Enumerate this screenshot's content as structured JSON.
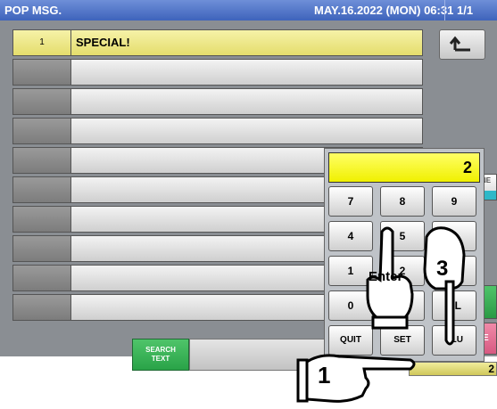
{
  "titlebar": {
    "title": "POP MSG.",
    "datetime": "MAY.16.2022 (MON) 06:31",
    "page": "1/1"
  },
  "list": {
    "rows": [
      {
        "num": "1",
        "text": "SPECIAL!"
      },
      {
        "num": "",
        "text": ""
      },
      {
        "num": "",
        "text": ""
      },
      {
        "num": "",
        "text": ""
      },
      {
        "num": "",
        "text": ""
      },
      {
        "num": "",
        "text": ""
      },
      {
        "num": "",
        "text": ""
      },
      {
        "num": "",
        "text": ""
      },
      {
        "num": "",
        "text": ""
      },
      {
        "num": "",
        "text": ""
      }
    ]
  },
  "side": {
    "partial_label_1": "NE",
    "partial_label_2": "E"
  },
  "bottom": {
    "search_label_1": "SEARCH",
    "search_label_2": "TEXT",
    "count": "2"
  },
  "keypad": {
    "display_value": "2",
    "keys": [
      "7",
      "8",
      "9",
      "4",
      "5",
      "6",
      "1",
      "2",
      "3",
      "0",
      "00",
      "CL",
      "QUIT",
      "SET",
      "PLU"
    ]
  },
  "callouts": {
    "step1": "1",
    "step2": "Enter",
    "step3": "3"
  },
  "colors": {
    "titlebar": "#3e63bb",
    "selected_row": "#e8e27a",
    "display": "#ffff33",
    "search_button": "#2fa84d"
  },
  "icons": {
    "back": "return-arrow-icon",
    "hands": "pointing-hand-icon"
  }
}
